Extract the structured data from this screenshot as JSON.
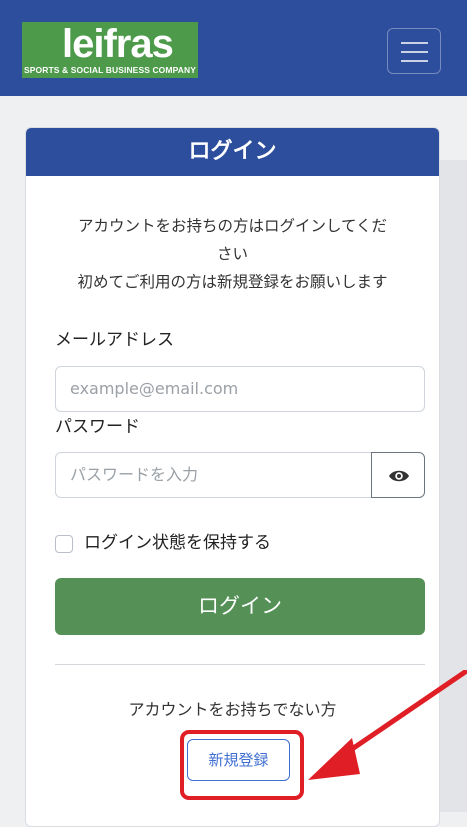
{
  "header": {
    "logo_text": "leifras",
    "logo_subtitle": "SPORTS & SOCIAL BUSINESS COMPANY"
  },
  "card": {
    "title": "ログイン",
    "intro_line1": "アカウントをお持ちの方はログインしてくだ",
    "intro_line2": "さい",
    "intro_line3": "初めてご利用の方は新規登録をお願いします"
  },
  "form": {
    "email_label": "メールアドレス",
    "email_placeholder": "example@email.com",
    "password_label": "パスワード",
    "password_placeholder": "パスワードを入力",
    "remember_label": "ログイン状態を保持する",
    "login_button": "ログイン"
  },
  "register": {
    "prompt": "アカウントをお持ちでない方",
    "button": "新規登録"
  },
  "colors": {
    "brand_blue": "#2d4e9c",
    "brand_green": "#4d9a4a",
    "login_green": "#559157",
    "annotation_red": "#e01e25"
  },
  "icons": [
    "hamburger-menu-icon",
    "eye-icon",
    "arrow-annotation"
  ]
}
